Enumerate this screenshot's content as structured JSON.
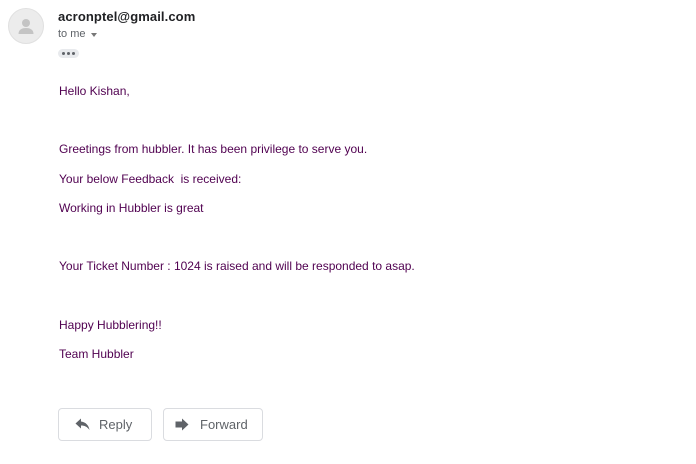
{
  "message": {
    "sender": "acronptel@gmail.com",
    "recipient_label": "to me",
    "body_lines": [
      "Hello Kishan,",
      "Greetings from hubbler. It has been privilege to serve you.",
      "Your below Feedback  is received:",
      "Working in Hubbler is great",
      "Your Ticket Number : 1024 is raised and will be responded to asap.",
      "Happy Hubblering!!",
      "Team Hubbler"
    ]
  },
  "actions": {
    "reply_label": "Reply",
    "forward_label": "Forward"
  },
  "icons": {
    "avatar": "person-icon",
    "recipient_caret": "caret-down-icon",
    "trimmed_content": "more-horizontal-icon",
    "reply": "reply-arrow-icon",
    "forward": "forward-arrow-icon"
  },
  "colors": {
    "body_text": "#500050",
    "sender_text": "#202124",
    "muted_text": "#5f6368",
    "button_border": "#dadce0"
  }
}
